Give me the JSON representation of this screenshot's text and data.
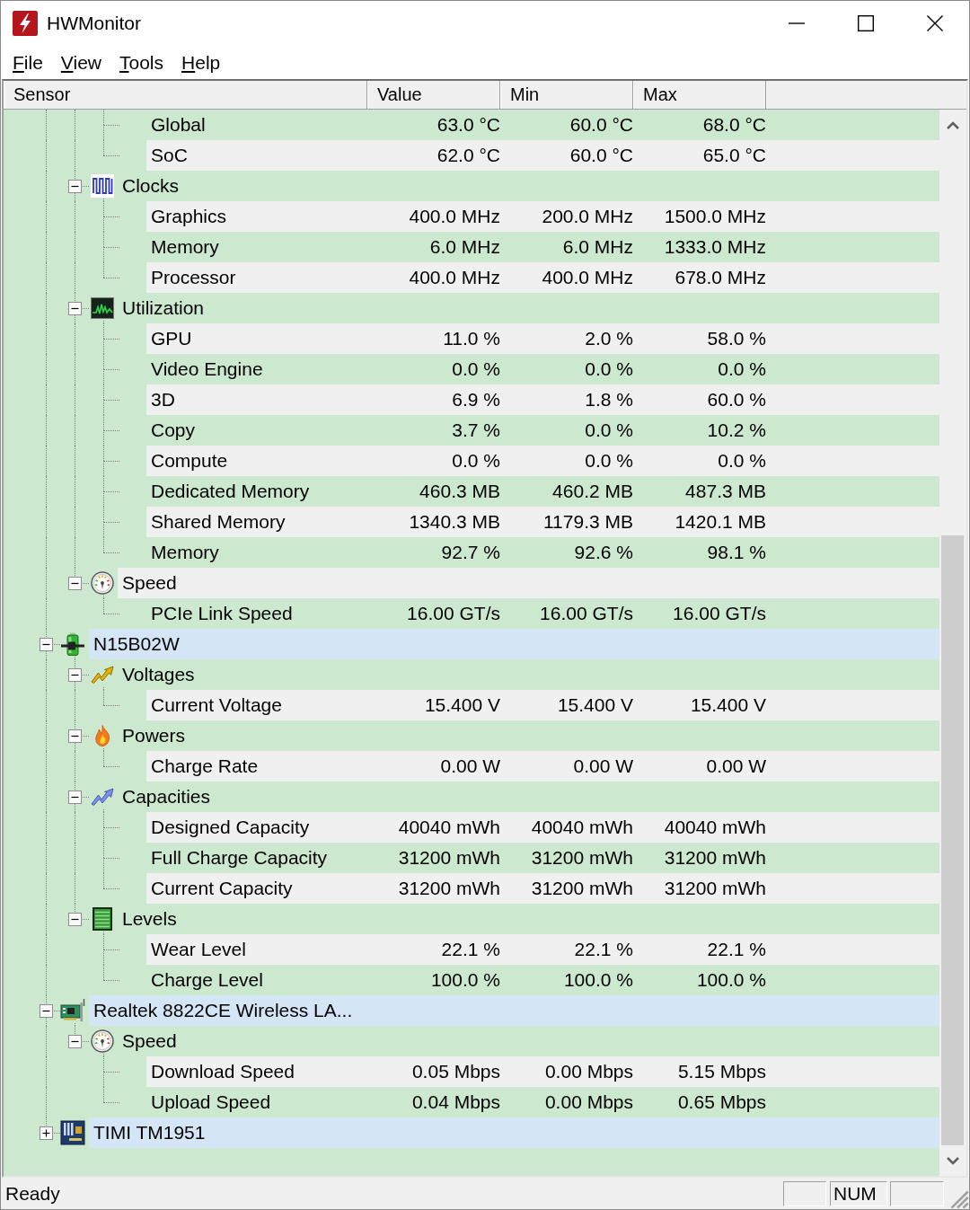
{
  "window": {
    "title": "HWMonitor"
  },
  "menu": [
    {
      "label": "File"
    },
    {
      "label": "View"
    },
    {
      "label": "Tools"
    },
    {
      "label": "Help"
    }
  ],
  "table": {
    "columns": [
      "Sensor",
      "Value",
      "Min",
      "Max"
    ],
    "items": [
      {
        "children": [
          {
            "children": [
              {
                "label": "Global",
                "value": "63.0 °C",
                "min": "60.0 °C",
                "max": "68.0 °C"
              },
              {
                "label": "SoC",
                "value": "62.0 °C",
                "min": "60.0 °C",
                "max": "65.0 °C"
              }
            ]
          },
          {
            "label": "Clocks",
            "kind": "clocks",
            "expanded": true,
            "children": [
              {
                "label": "Graphics",
                "value": "400.0 MHz",
                "min": "200.0 MHz",
                "max": "1500.0 MHz"
              },
              {
                "label": "Memory",
                "value": "6.0 MHz",
                "min": "6.0 MHz",
                "max": "1333.0 MHz"
              },
              {
                "label": "Processor",
                "value": "400.0 MHz",
                "min": "400.0 MHz",
                "max": "678.0 MHz"
              }
            ]
          },
          {
            "label": "Utilization",
            "kind": "utilization",
            "expanded": true,
            "children": [
              {
                "label": "GPU",
                "value": "11.0 %",
                "min": "2.0 %",
                "max": "58.0 %"
              },
              {
                "label": "Video Engine",
                "value": "0.0 %",
                "min": "0.0 %",
                "max": "0.0 %"
              },
              {
                "label": "3D",
                "value": "6.9 %",
                "min": "1.8 %",
                "max": "60.0 %"
              },
              {
                "label": "Copy",
                "value": "3.7 %",
                "min": "0.0 %",
                "max": "10.2 %"
              },
              {
                "label": "Compute",
                "value": "0.0 %",
                "min": "0.0 %",
                "max": "0.0 %"
              },
              {
                "label": "Dedicated Memory",
                "value": "460.3 MB",
                "min": "460.2 MB",
                "max": "487.3 MB"
              },
              {
                "label": "Shared Memory",
                "value": "1340.3 MB",
                "min": "1179.3 MB",
                "max": "1420.1 MB"
              },
              {
                "label": "Memory",
                "value": "92.7 %",
                "min": "92.6 %",
                "max": "98.1 %"
              }
            ]
          },
          {
            "label": "Speed",
            "kind": "speed",
            "expanded": true,
            "children": [
              {
                "label": "PCIe Link Speed",
                "value": "16.00 GT/s",
                "min": "16.00 GT/s",
                "max": "16.00 GT/s"
              }
            ]
          }
        ]
      },
      {
        "label": "N15B02W",
        "kind": "battery",
        "expanded": true,
        "children": [
          {
            "label": "Voltages",
            "kind": "voltages",
            "expanded": true,
            "children": [
              {
                "label": "Current Voltage",
                "value": "15.400 V",
                "min": "15.400 V",
                "max": "15.400 V"
              }
            ]
          },
          {
            "label": "Powers",
            "kind": "powers",
            "expanded": true,
            "children": [
              {
                "label": "Charge Rate",
                "value": "0.00 W",
                "min": "0.00 W",
                "max": "0.00 W"
              }
            ]
          },
          {
            "label": "Capacities",
            "kind": "capacities",
            "expanded": true,
            "children": [
              {
                "label": "Designed Capacity",
                "value": "40040 mWh",
                "min": "40040 mWh",
                "max": "40040 mWh"
              },
              {
                "label": "Full Charge Capacity",
                "value": "31200 mWh",
                "min": "31200 mWh",
                "max": "31200 mWh"
              },
              {
                "label": "Current Capacity",
                "value": "31200 mWh",
                "min": "31200 mWh",
                "max": "31200 mWh"
              }
            ]
          },
          {
            "label": "Levels",
            "kind": "levels",
            "expanded": true,
            "children": [
              {
                "label": "Wear Level",
                "value": "22.1 %",
                "min": "22.1 %",
                "max": "22.1 %"
              },
              {
                "label": "Charge Level",
                "value": "100.0 %",
                "min": "100.0 %",
                "max": "100.0 %"
              }
            ]
          }
        ]
      },
      {
        "label": "Realtek 8822CE Wireless LA...",
        "kind": "network",
        "expanded": true,
        "children": [
          {
            "label": "Speed",
            "kind": "speed",
            "expanded": true,
            "children": [
              {
                "label": "Download Speed",
                "value": "0.05 Mbps",
                "min": "0.00 Mbps",
                "max": "5.15 Mbps"
              },
              {
                "label": "Upload Speed",
                "value": "0.04 Mbps",
                "min": "0.00 Mbps",
                "max": "0.65 Mbps"
              }
            ]
          }
        ]
      },
      {
        "label": "TIMI TM1951",
        "kind": "mainboard",
        "expanded": false
      }
    ]
  },
  "status_bar": {
    "message": "Ready",
    "indicator": "NUM"
  }
}
